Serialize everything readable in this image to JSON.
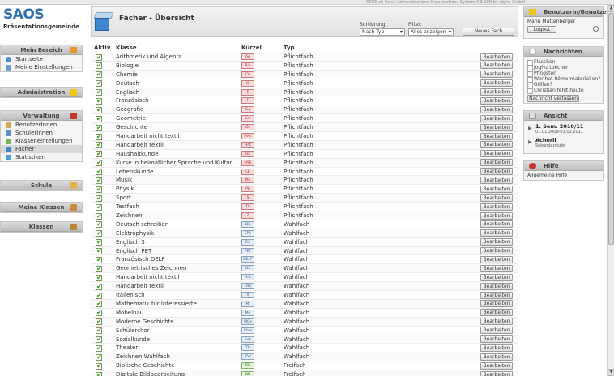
{
  "app": {
    "system_title": "SAOS.ch Schul-Administrations-Organisations-System 0.5.100 by digira GmbH",
    "logo": "SAOS",
    "tenant": "Präsentationsgemeinde"
  },
  "sidebar": {
    "mein_bereich": {
      "title": "Mein Bereich",
      "items": [
        "Startseite",
        "Meine Einstellungen"
      ]
    },
    "administration": {
      "title": "Administration"
    },
    "verwaltung": {
      "title": "Verwaltung",
      "items": [
        "BenutzerInnen",
        "SchülerInnen",
        "Klasseneinteilungen",
        "Fächer",
        "Statistiken"
      ]
    },
    "schule": {
      "title": "Schule"
    },
    "meine_klassen": {
      "title": "Meine Klassen"
    },
    "klassen": {
      "title": "Klassen"
    }
  },
  "main": {
    "title": "Fächer - Übersicht",
    "sort_label": "Sortierung:",
    "sort_value": "Nach Typ",
    "filter_label": "Filter:",
    "filter_value": "Alles anzeigen",
    "new_button": "Neues Fach",
    "columns": {
      "active": "Aktiv",
      "class": "Klasse",
      "short": "Kürzel",
      "type": "Typ"
    },
    "edit_label": "Bearbeiten",
    "rows": [
      {
        "name": "Arithmetik und Algebra",
        "code": "AA",
        "type": "Pflichtfach"
      },
      {
        "name": "Biologie",
        "code": "Bio",
        "type": "Pflichtfach"
      },
      {
        "name": "Chemie",
        "code": "Ch",
        "type": "Pflichtfach"
      },
      {
        "name": "Deutsch",
        "code": "D",
        "type": "Pflichtfach"
      },
      {
        "name": "Englisch",
        "code": "E",
        "type": "Pflichtfach"
      },
      {
        "name": "Französisch",
        "code": "F",
        "type": "Pflichtfach"
      },
      {
        "name": "Geografie",
        "code": "Gg",
        "type": "Pflichtfach"
      },
      {
        "name": "Geometrie",
        "code": "Gm",
        "type": "Pflichtfach"
      },
      {
        "name": "Geschichte",
        "code": "Gs",
        "type": "Pflichtfach"
      },
      {
        "name": "Handarbeit nicht textil",
        "code": "HAn",
        "type": "Pflichtfach"
      },
      {
        "name": "Handarbeit textil",
        "code": "HAt",
        "type": "Pflichtfach"
      },
      {
        "name": "Haushaltkunde",
        "code": "Hk",
        "type": "Pflichtfach"
      },
      {
        "name": "Kurse in heimatlicher Sprache und Kultur",
        "code": "HSK",
        "type": "Pflichtfach"
      },
      {
        "name": "Lebenskunde",
        "code": "LK",
        "type": "Pflichtfach"
      },
      {
        "name": "Musik",
        "code": "Mu",
        "type": "Pflichtfach"
      },
      {
        "name": "Physik",
        "code": "Ph",
        "type": "Pflichtfach"
      },
      {
        "name": "Sport",
        "code": "S",
        "type": "Pflichtfach"
      },
      {
        "name": "Testfach",
        "code": "TF",
        "type": "Pflichtfach"
      },
      {
        "name": "Zeichnen",
        "code": "Z",
        "type": "Pflichtfach"
      },
      {
        "name": "Deutsch schreiben",
        "code": "DS",
        "type": "Wahlfach"
      },
      {
        "name": "Elektrophysik",
        "code": "EPh",
        "type": "Wahlfach"
      },
      {
        "name": "Englisch 3",
        "code": "E3",
        "type": "Wahlfach"
      },
      {
        "name": "Englisch PET",
        "code": "PET",
        "type": "Wahlfach"
      },
      {
        "name": "Französisch DELF",
        "code": "DELF",
        "type": "Wahlfach"
      },
      {
        "name": "Geometrisches Zeichnen",
        "code": "GZ",
        "type": "Wahlfach"
      },
      {
        "name": "Handarbeit nicht textil",
        "code": "Hnt",
        "type": "Wahlfach"
      },
      {
        "name": "Handarbeit textil",
        "code": "Htx",
        "type": "Wahlfach"
      },
      {
        "name": "Italienisch",
        "code": "It",
        "type": "Wahlfach"
      },
      {
        "name": "Mathematik für Interessierte",
        "code": "MI",
        "type": "Wahlfach"
      },
      {
        "name": "Möbelbau",
        "code": "Mö",
        "type": "Wahlfach"
      },
      {
        "name": "Moderne Geschichte",
        "code": "MGs",
        "type": "Wahlfach"
      },
      {
        "name": "Schülerchor",
        "code": "Chor",
        "type": "Wahlfach"
      },
      {
        "name": "Sozialkunde",
        "code": "Sok",
        "type": "Wahlfach"
      },
      {
        "name": "Theater",
        "code": "Th",
        "type": "Wahlfach"
      },
      {
        "name": "Zeichnen Wahlfach",
        "code": "ZW",
        "type": "Wahlfach"
      },
      {
        "name": "Biblische Geschichte",
        "code": "BG",
        "type": "Freifach"
      },
      {
        "name": "Digitale Bildbearbeitung",
        "code": "DB",
        "type": "Freifach"
      }
    ]
  },
  "right": {
    "user": {
      "title": "Benutzerin/Benutzer",
      "name": "Manu Mattenberger",
      "logout": "Logout"
    },
    "news": {
      "title": "Nachrichten",
      "items": [
        "Flaschen",
        "Joghurtbecher",
        "Pfingsten",
        "Wer hat Römermaterialien?",
        "Grillen?",
        "Christian fehlt heute"
      ],
      "compose": "Nachricht verfassen"
    },
    "view": {
      "title": "Ansicht",
      "semester": "1. Sem. 2010/11",
      "dates": "01.01.2009-03.02.2011",
      "school": "Acherli",
      "level": "Sekundarstufe"
    },
    "help": {
      "title": "Hilfe",
      "link": "Allgemeine Hilfe"
    }
  },
  "colors": {
    "pflicht_bg": "#f7dada",
    "pflicht_border": "#c97c7c",
    "pflicht_text": "#b33a3a",
    "wahl_bg": "#e4ecf5",
    "wahl_border": "#8aa3bf",
    "wahl_text": "#4a6a8a",
    "frei_bg": "#e2f2dc",
    "frei_border": "#7fb36b",
    "frei_text": "#3f7d2a"
  }
}
